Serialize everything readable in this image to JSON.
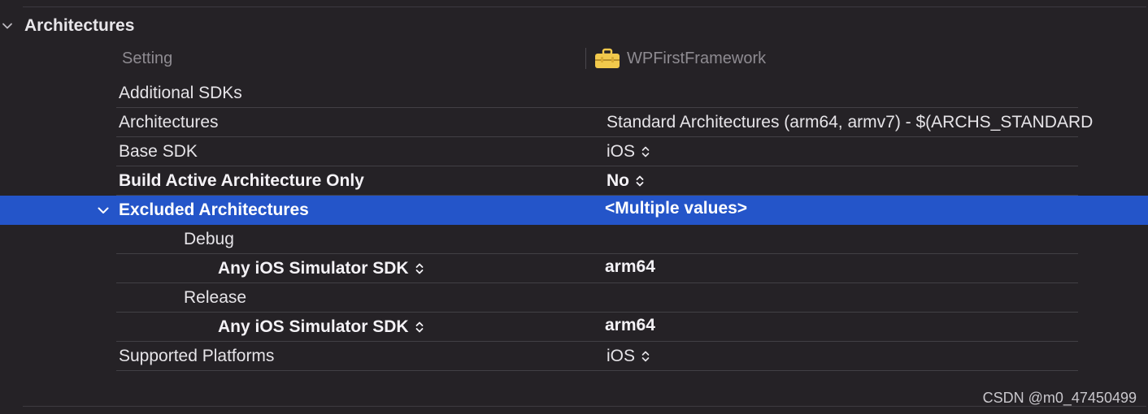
{
  "section": {
    "title": "Architectures"
  },
  "columns": {
    "setting_label": "Setting",
    "target_label": "WPFirstFramework"
  },
  "rows": [
    {
      "name": "Additional SDKs",
      "value": ""
    },
    {
      "name": "Architectures",
      "value": "Standard Architectures (arm64, armv7)  -  $(ARCHS_STANDARD"
    },
    {
      "name": "Base SDK",
      "value": "iOS"
    },
    {
      "name": "Build Active Architecture Only",
      "value": "No"
    },
    {
      "name": "Excluded Architectures",
      "value": "<Multiple values>"
    },
    {
      "name": "Debug",
      "value": ""
    },
    {
      "name": "Any iOS Simulator SDK",
      "value": "arm64"
    },
    {
      "name": "Release",
      "value": ""
    },
    {
      "name": "Any iOS Simulator SDK",
      "value": "arm64"
    },
    {
      "name": "Supported Platforms",
      "value": "iOS"
    }
  ],
  "icons": {
    "section_toggle": "chevron-down-icon",
    "target": "toolbox-icon",
    "row_toggle": "chevron-down-icon",
    "popup": "up-down-stepper-icon"
  },
  "colors": {
    "background": "#252226",
    "selection": "#2455c9",
    "target_icon": "#f2c94c"
  },
  "watermark": "CSDN @m0_47450499"
}
